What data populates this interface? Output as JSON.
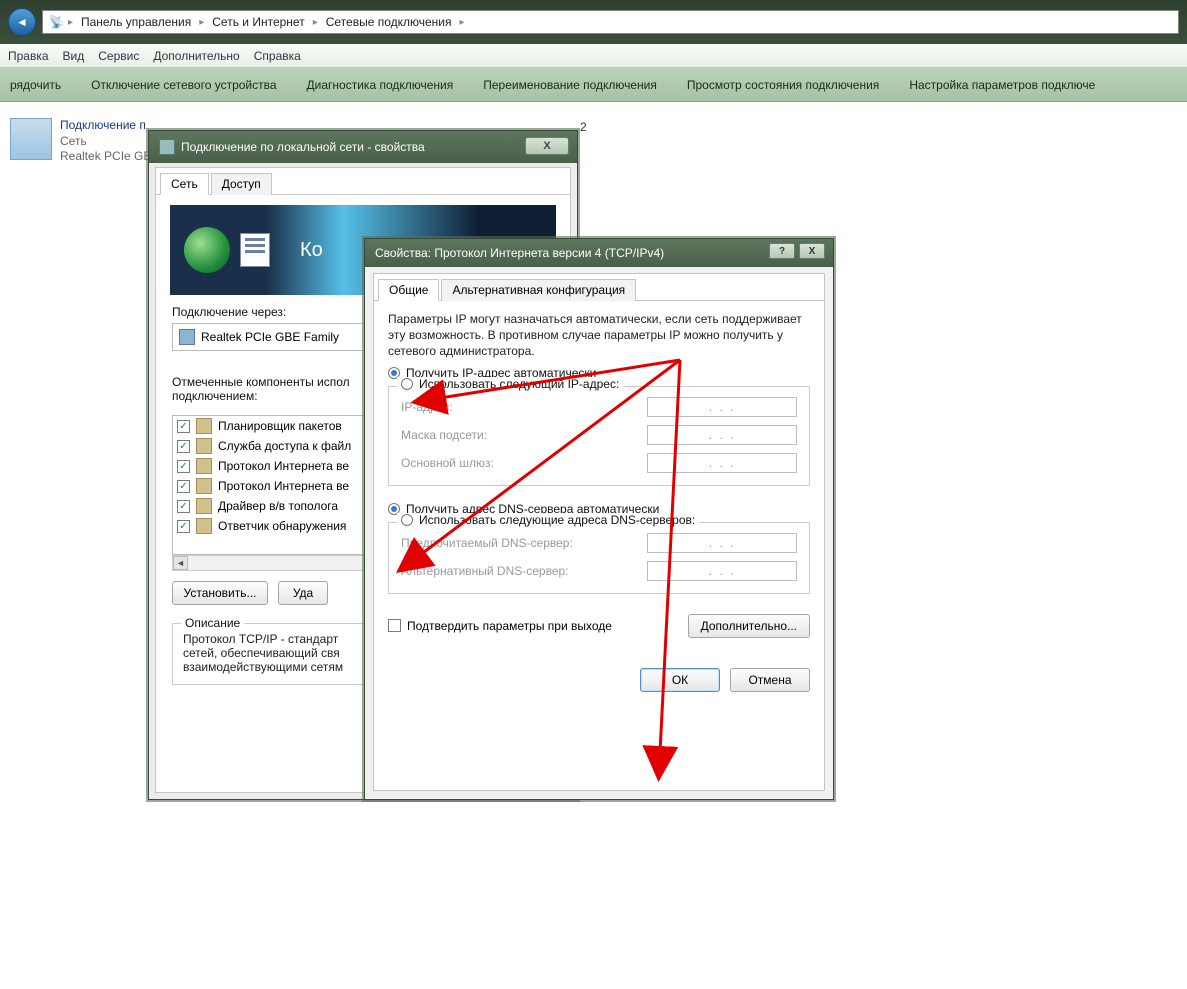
{
  "breadcrumbs": {
    "item0": "Панель управления",
    "item1": "Сеть и Интернет",
    "item2": "Сетевые подключения"
  },
  "menu": {
    "edit": "Правка",
    "view": "Вид",
    "service": "Сервис",
    "extra": "Дополнительно",
    "help": "Справка"
  },
  "toolbar": {
    "organize": "рядочить",
    "disable": "Отключение сетевого устройства",
    "diagnose": "Диагностика подключения",
    "rename": "Переименование подключения",
    "status": "Просмотр состояния подключения",
    "settings": "Настройка параметров подключе"
  },
  "connection": {
    "name": "Подключение п",
    "line2": "Сеть",
    "line3": "Realtek PCIe GB",
    "suffix_2": " 2"
  },
  "dialog1": {
    "title": "Подключение по локальной сети - свойства",
    "tab_net": "Сеть",
    "tab_access": "Доступ",
    "banner_text": "Ко",
    "connect_via": "Подключение через:",
    "device": "Realtek PCIe GBE Family",
    "components_label": "Отмеченные компоненты испол\nподключением:",
    "components": [
      "Планировщик пакетов",
      "Служба доступа к файл",
      "Протокол Интернета ве",
      "Протокол Интернета ве",
      "Драйвер в/в тополога",
      "Ответчик обнаружения"
    ],
    "install": "Установить...",
    "uninstall": "Уда",
    "desc_title": "Описание",
    "desc_text": "Протокол TCP/IP - стандарт\nсетей, обеспечивающий свя\nвзаимодействующими сетям"
  },
  "dialog2": {
    "title": "Свойства: Протокол Интернета версии 4 (TCP/IPv4)",
    "tab_general": "Общие",
    "tab_alt": "Альтернативная конфигурация",
    "info": "Параметры IP могут назначаться автоматически, если сеть поддерживает эту возможность. В противном случае параметры IP можно получить у сетевого администратора.",
    "radio_ip_auto": "Получить IP-адрес автоматически",
    "radio_ip_manual": "Использовать следующий IP-адрес:",
    "ip_addr": "IP-адрес:",
    "subnet": "Маска подсети:",
    "gateway": "Основной шлюз:",
    "radio_dns_auto": "Получить адрес DNS-сервера автоматически",
    "radio_dns_manual": "Использовать следующие адреса DNS-серверов:",
    "dns_pref": "Предпочитаемый DNS-сервер:",
    "dns_alt": "Альтернативный DNS-сервер:",
    "confirm": "Подтвердить параметры при выходе",
    "advanced": "Дополнительно...",
    "ok": "ОК",
    "cancel": "Отмена",
    "ip_placeholder": ".    .    ."
  }
}
